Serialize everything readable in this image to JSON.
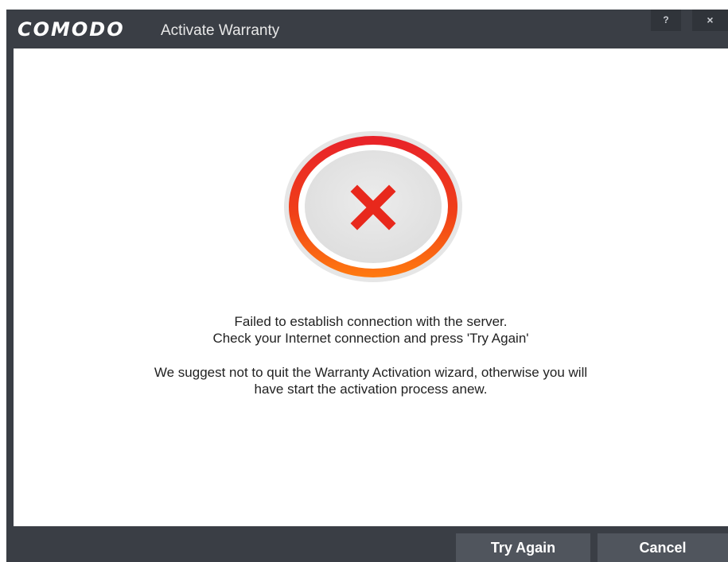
{
  "titlebar": {
    "logo": "COMODO",
    "title": "Activate Warranty",
    "help_label": "?",
    "close_label": "×"
  },
  "status": {
    "icon": "error-x-icon",
    "colors": {
      "ring_outer": "#e8222a",
      "ring_inner": "#ff7a10",
      "cross": "#e8281c",
      "center": "#e5e5e5"
    }
  },
  "messages": {
    "line1": "Failed to establish connection with the server.",
    "line2": "Check your Internet connection and press 'Try Again'",
    "line3": "We suggest not to quit the Warranty Activation wizard, otherwise you will",
    "line4": "have start the activation process anew."
  },
  "footer": {
    "try_again_label": "Try Again",
    "cancel_label": "Cancel"
  }
}
